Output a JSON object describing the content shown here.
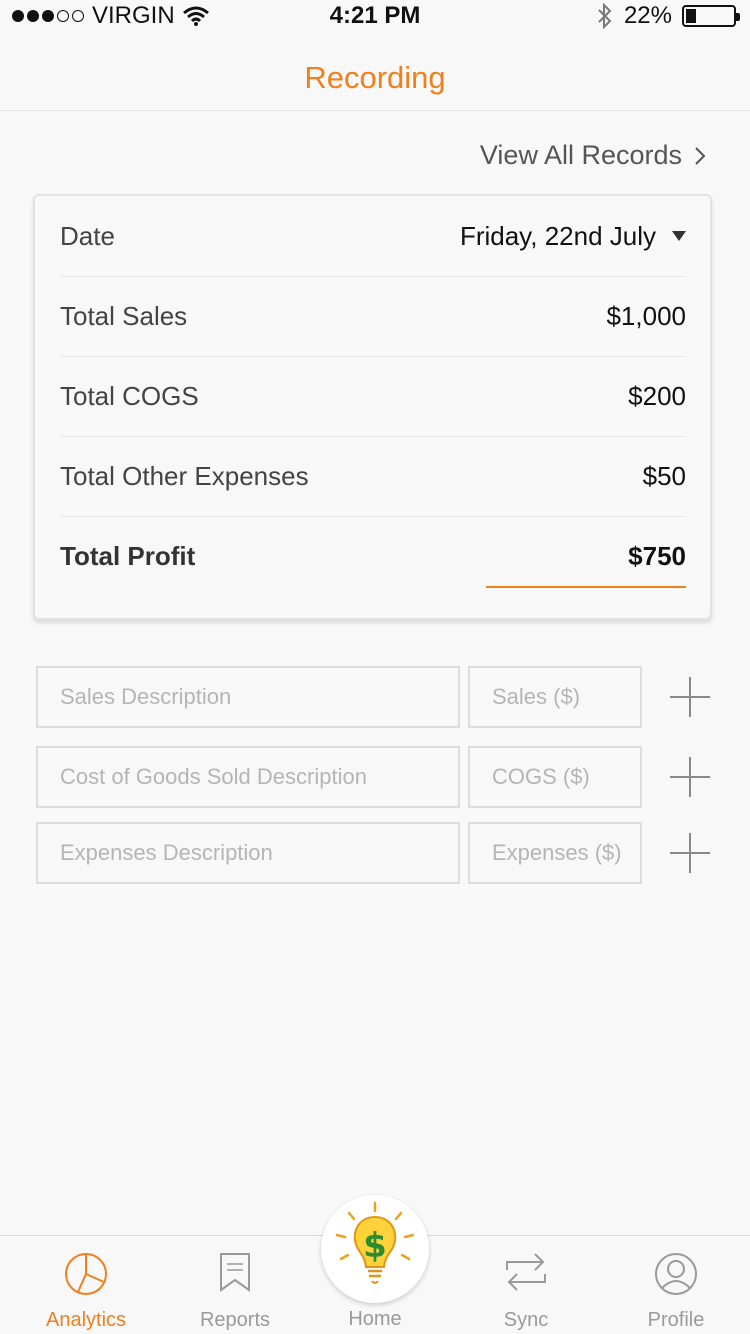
{
  "status_bar": {
    "carrier": "VIRGIN",
    "time": "4:21 PM",
    "battery_pct": "22%",
    "battery_level": 0.22,
    "signal_bars": 3,
    "signal_total": 5
  },
  "nav": {
    "title": "Recording"
  },
  "view_all_label": "View All Records",
  "summary": {
    "date_label": "Date",
    "date_value": "Friday, 22nd July",
    "rows": [
      {
        "label": "Total Sales",
        "value": "$1,000"
      },
      {
        "label": "Total COGS",
        "value": "$200"
      },
      {
        "label": "Total Other Expenses",
        "value": "$50"
      }
    ],
    "profit_label": "Total Profit",
    "profit_value": "$750"
  },
  "entry": {
    "sales_desc_placeholder": "Sales Description",
    "sales_amount_placeholder": "Sales ($)",
    "cogs_desc_placeholder": "Cost of Goods Sold Description",
    "cogs_amount_placeholder": "COGS ($)",
    "expenses_desc_placeholder": "Expenses Description",
    "expenses_amount_placeholder": "Expenses ($)"
  },
  "tabs": {
    "analytics": "Analytics",
    "reports": "Reports",
    "home": "Home",
    "sync": "Sync",
    "profile": "Profile"
  },
  "colors": {
    "accent": "#f07f1e",
    "inactive": "#9a9a9a"
  }
}
